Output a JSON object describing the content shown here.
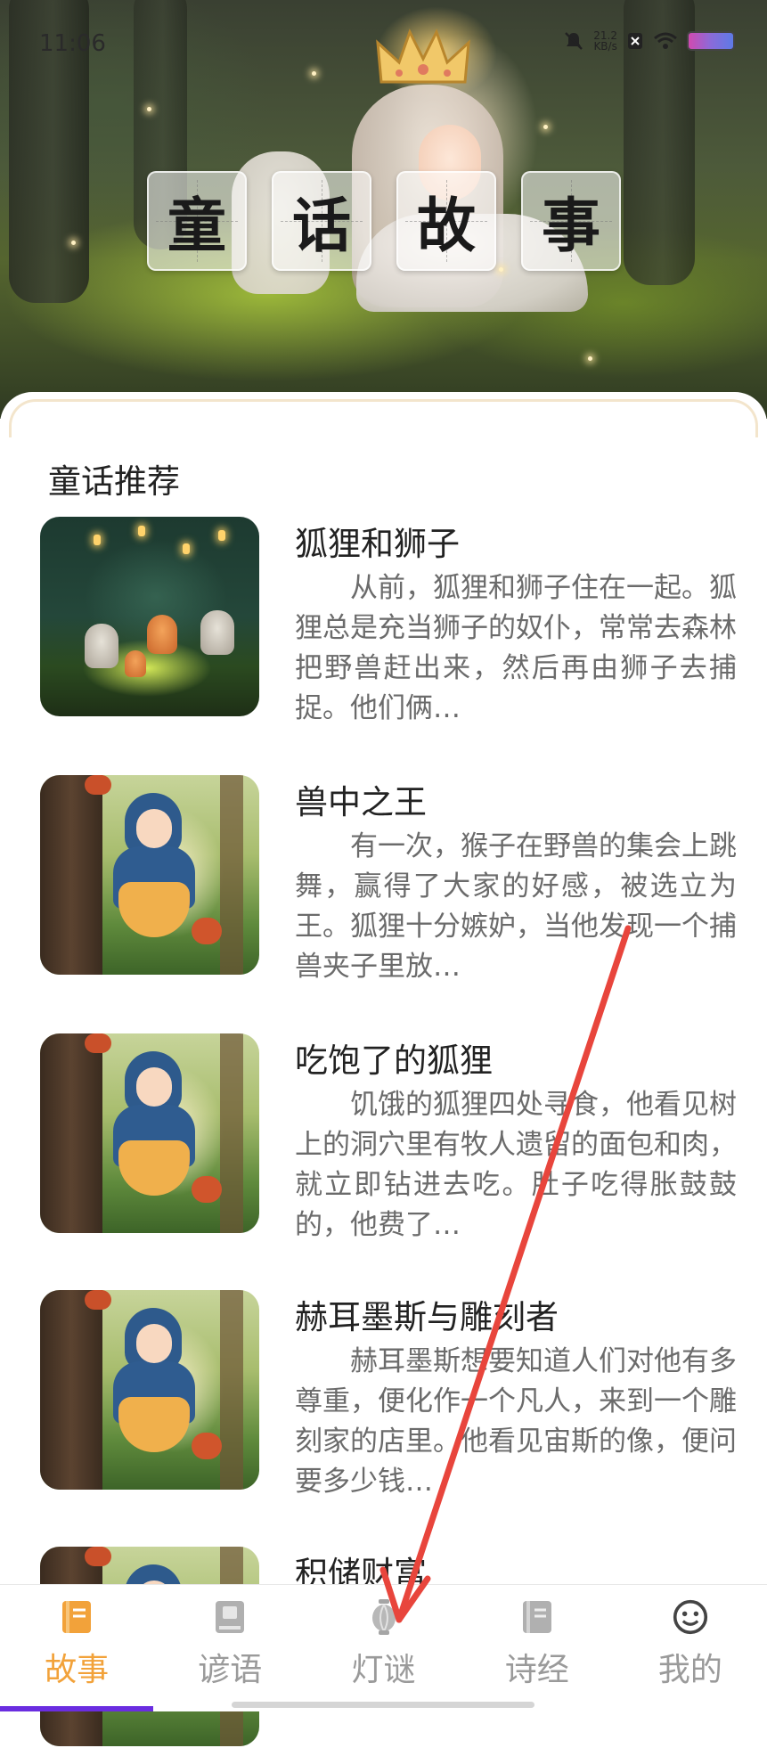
{
  "status_bar": {
    "time": "11:06",
    "net_speed": "21.2",
    "net_unit": "KB/s"
  },
  "header": {
    "title_chars": [
      "童",
      "话",
      "故",
      "事"
    ]
  },
  "section": {
    "title": "童话推荐"
  },
  "stories": [
    {
      "title": "狐狸和狮子",
      "summary": "从前，狐狸和狮子住在一起。狐狸总是充当狮子的奴仆，常常去森林把野兽赶出来，然后再由狮子去捕捉。他们俩…"
    },
    {
      "title": "兽中之王",
      "summary": "有一次，猴子在野兽的集会上跳舞，赢得了大家的好感，被选立为王。狐狸十分嫉妒，当他发现一个捕兽夹子里放…"
    },
    {
      "title": "吃饱了的狐狸",
      "summary": "饥饿的狐狸四处寻食，他看见树上的洞穴里有牧人遗留的面包和肉，就立即钻进去吃。肚子吃得胀鼓鼓的，他费了…"
    },
    {
      "title": "赫耳墨斯与雕刻者",
      "summary": "赫耳墨斯想要知道人们对他有多尊重，便化作一个凡人，来到一个雕刻家的店里。他看见宙斯的像，便问要多少钱…"
    },
    {
      "title": "积储财富",
      "summary": ""
    }
  ],
  "nav": {
    "items": [
      {
        "label": "故事",
        "icon": "book-icon",
        "active": true
      },
      {
        "label": "谚语",
        "icon": "proverb-book-icon",
        "active": false
      },
      {
        "label": "灯谜",
        "icon": "lantern-icon",
        "active": false
      },
      {
        "label": "诗经",
        "icon": "poetry-book-icon",
        "active": false
      },
      {
        "label": "我的",
        "icon": "smiley-icon",
        "active": false
      }
    ]
  },
  "colors": {
    "accent": "#f2a23a",
    "inactive": "#9a9a9a",
    "annotation_arrow": "#e8453c"
  }
}
